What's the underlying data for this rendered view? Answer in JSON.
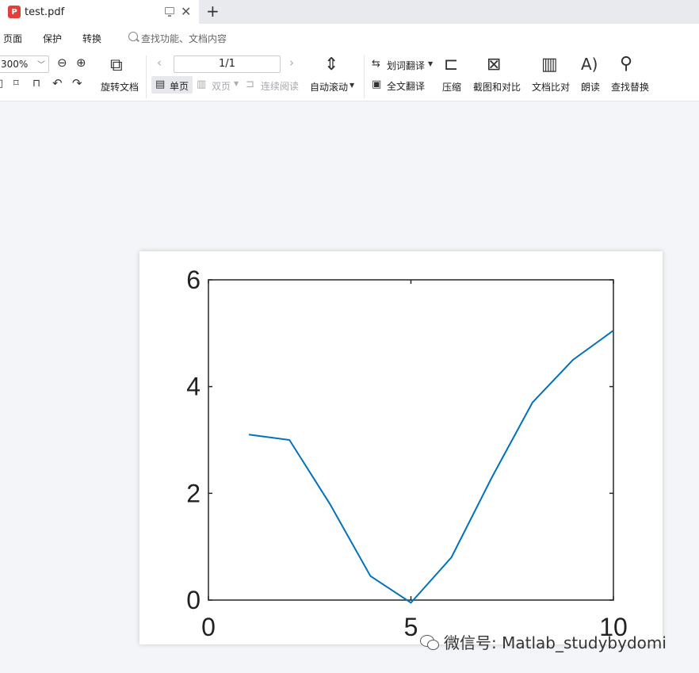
{
  "tab": {
    "title": "test.pdf",
    "close": "✕",
    "new": "+"
  },
  "menu": {
    "items": [
      "页面",
      "保护",
      "转换"
    ],
    "search_placeholder": "查找功能、文档内容"
  },
  "toolbar": {
    "zoom": "300%",
    "page_indicator": "1/1",
    "rotate_doc": "旋转文档",
    "single_page": "单页",
    "double_page": "双页",
    "continuous_read": "连续阅读",
    "auto_scroll": "自动滚动",
    "word_translate": "划词翻译",
    "full_translate": "全文翻译",
    "compress": "压缩",
    "screenshot_compare": "截图和对比",
    "doc_compare": "文档比对",
    "read_aloud": "朗读",
    "find_replace": "查找替换"
  },
  "watermark": "微信号: Matlab_studybydomi",
  "chart_data": {
    "type": "line",
    "x": [
      1,
      2,
      3,
      4,
      5,
      6,
      7,
      8,
      9,
      10
    ],
    "values": [
      3.1,
      3.0,
      1.8,
      0.45,
      -0.05,
      0.8,
      2.3,
      3.7,
      4.5,
      5.05
    ],
    "xlim": [
      0,
      10
    ],
    "ylim": [
      0,
      6
    ],
    "xticks": [
      0,
      5,
      10
    ],
    "yticks": [
      0,
      2,
      4,
      6
    ],
    "title": "",
    "xlabel": "",
    "ylabel": "",
    "line_color": "#0072bd",
    "grid": false
  }
}
